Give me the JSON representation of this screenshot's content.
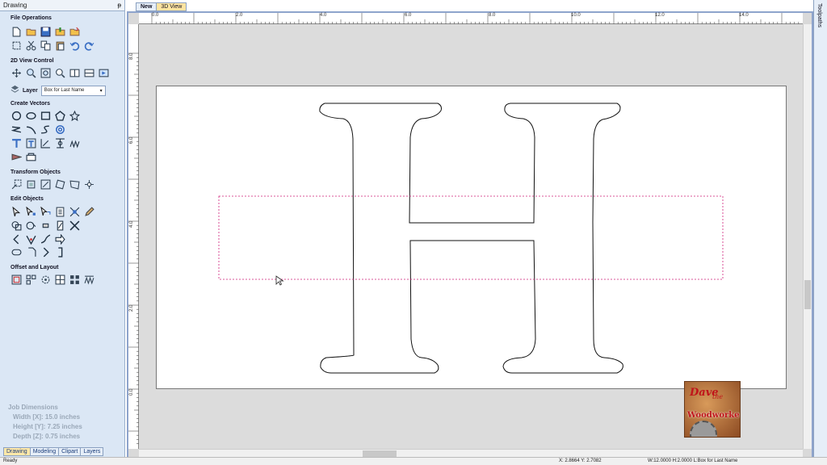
{
  "panel": {
    "title": "Drawing",
    "pin": "ᵽ",
    "sections": {
      "file": "File Operations",
      "view2d": "2D View Control",
      "create": "Create Vectors",
      "transform": "Transform Objects",
      "edit": "Edit Objects",
      "offset": "Offset and Layout"
    },
    "layer": {
      "label": "Layer",
      "value": "Box for Last Name"
    },
    "job": {
      "title": "Job Dimensions",
      "width": "Width  [X]: 15.0 inches",
      "height": "Height [Y]: 7.25 inches",
      "depth": "Depth  [Z]: 0.75 inches"
    },
    "tabs": [
      "Drawing",
      "Modeling",
      "Clipart",
      "Layers"
    ]
  },
  "doc_tabs": [
    "New",
    "3D View"
  ],
  "ruler": {
    "top": [
      "0.0",
      "2.0",
      "4.0",
      "6.0",
      "8.0",
      "10.0",
      "12.0",
      "14.0"
    ],
    "left": [
      "8.0",
      "6.0",
      "4.0",
      "2.0",
      "0.0"
    ]
  },
  "right_panel": {
    "label": "Toolpaths"
  },
  "status": {
    "ready": "Ready",
    "xy": "X: 2.8664 Y: 2.7082",
    "wh": "W:12.0000  H:2.0000  L:Box for Last Name"
  },
  "logo": {
    "line1": "Dave",
    "line2": "the",
    "line3": "Woodworker"
  },
  "colors": {
    "panel_bg": "#dbe7f5",
    "selection": "#d0207a",
    "active_tab": "#ffe8a8"
  }
}
